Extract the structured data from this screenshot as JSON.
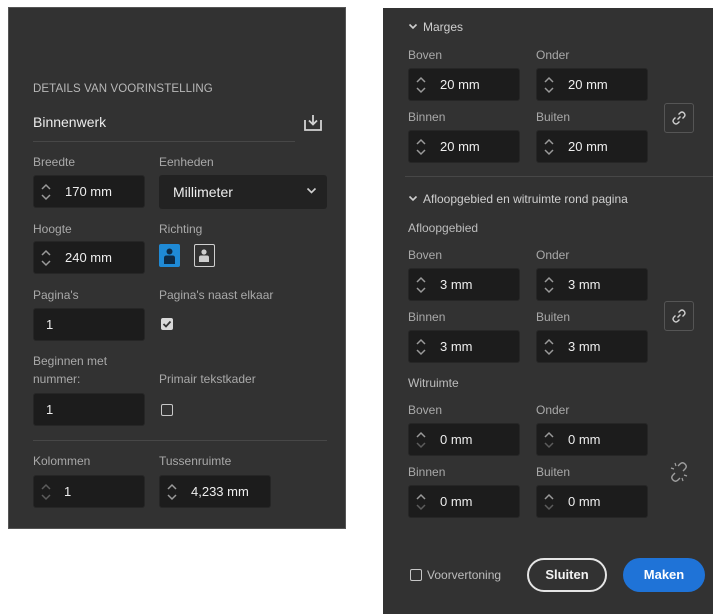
{
  "left": {
    "section_title": "DETAILS VAN VOORINSTELLING",
    "preset_name": "Binnenwerk",
    "save_preset_icon": "download-icon",
    "width_label": "Breedte",
    "width_value": "170 mm",
    "units_label": "Eenheden",
    "units_value": "Millimeter",
    "height_label": "Hoogte",
    "height_value": "240 mm",
    "orientation_label": "Richting",
    "orientation_selected": "portrait",
    "pages_label": "Pagina's",
    "pages_value": "1",
    "facing_pages_label": "Pagina's naast elkaar",
    "facing_pages_checked": true,
    "start_number_label_line1": "Beginnen met",
    "start_number_label_line2": "nummer:",
    "start_number_value": "1",
    "primary_text_frame_label": "Primair tekstkader",
    "primary_text_frame_checked": false,
    "columns_label": "Kolommen",
    "columns_value": "1",
    "gutter_label": "Tussenruimte",
    "gutter_value": "4,233 mm"
  },
  "right": {
    "margins_title": "Marges",
    "margins": {
      "top_label": "Boven",
      "top_value": "20 mm",
      "bottom_label": "Onder",
      "bottom_value": "20 mm",
      "inside_label": "Binnen",
      "inside_value": "20 mm",
      "outside_label": "Buiten",
      "outside_value": "20 mm"
    },
    "bleed_slug_title": "Afloopgebied en witruimte rond pagina",
    "bleed_title": "Afloopgebied",
    "bleed": {
      "top_label": "Boven",
      "top_value": "3 mm",
      "bottom_label": "Onder",
      "bottom_value": "3 mm",
      "inside_label": "Binnen",
      "inside_value": "3 mm",
      "outside_label": "Buiten",
      "outside_value": "3 mm"
    },
    "slug_title": "Witruimte",
    "slug": {
      "top_label": "Boven",
      "top_value": "0 mm",
      "bottom_label": "Onder",
      "bottom_value": "0 mm",
      "inside_label": "Binnen",
      "inside_value": "0 mm",
      "outside_label": "Buiten",
      "outside_value": "0 mm"
    },
    "preview_label": "Voorvertoning",
    "preview_checked": false,
    "close_label": "Sluiten",
    "create_label": "Maken"
  },
  "colors": {
    "panel_bg": "#323232",
    "field_bg": "#1c1c1c",
    "accent": "#1f73d7",
    "orientation_selected": "#1f8ad6"
  }
}
